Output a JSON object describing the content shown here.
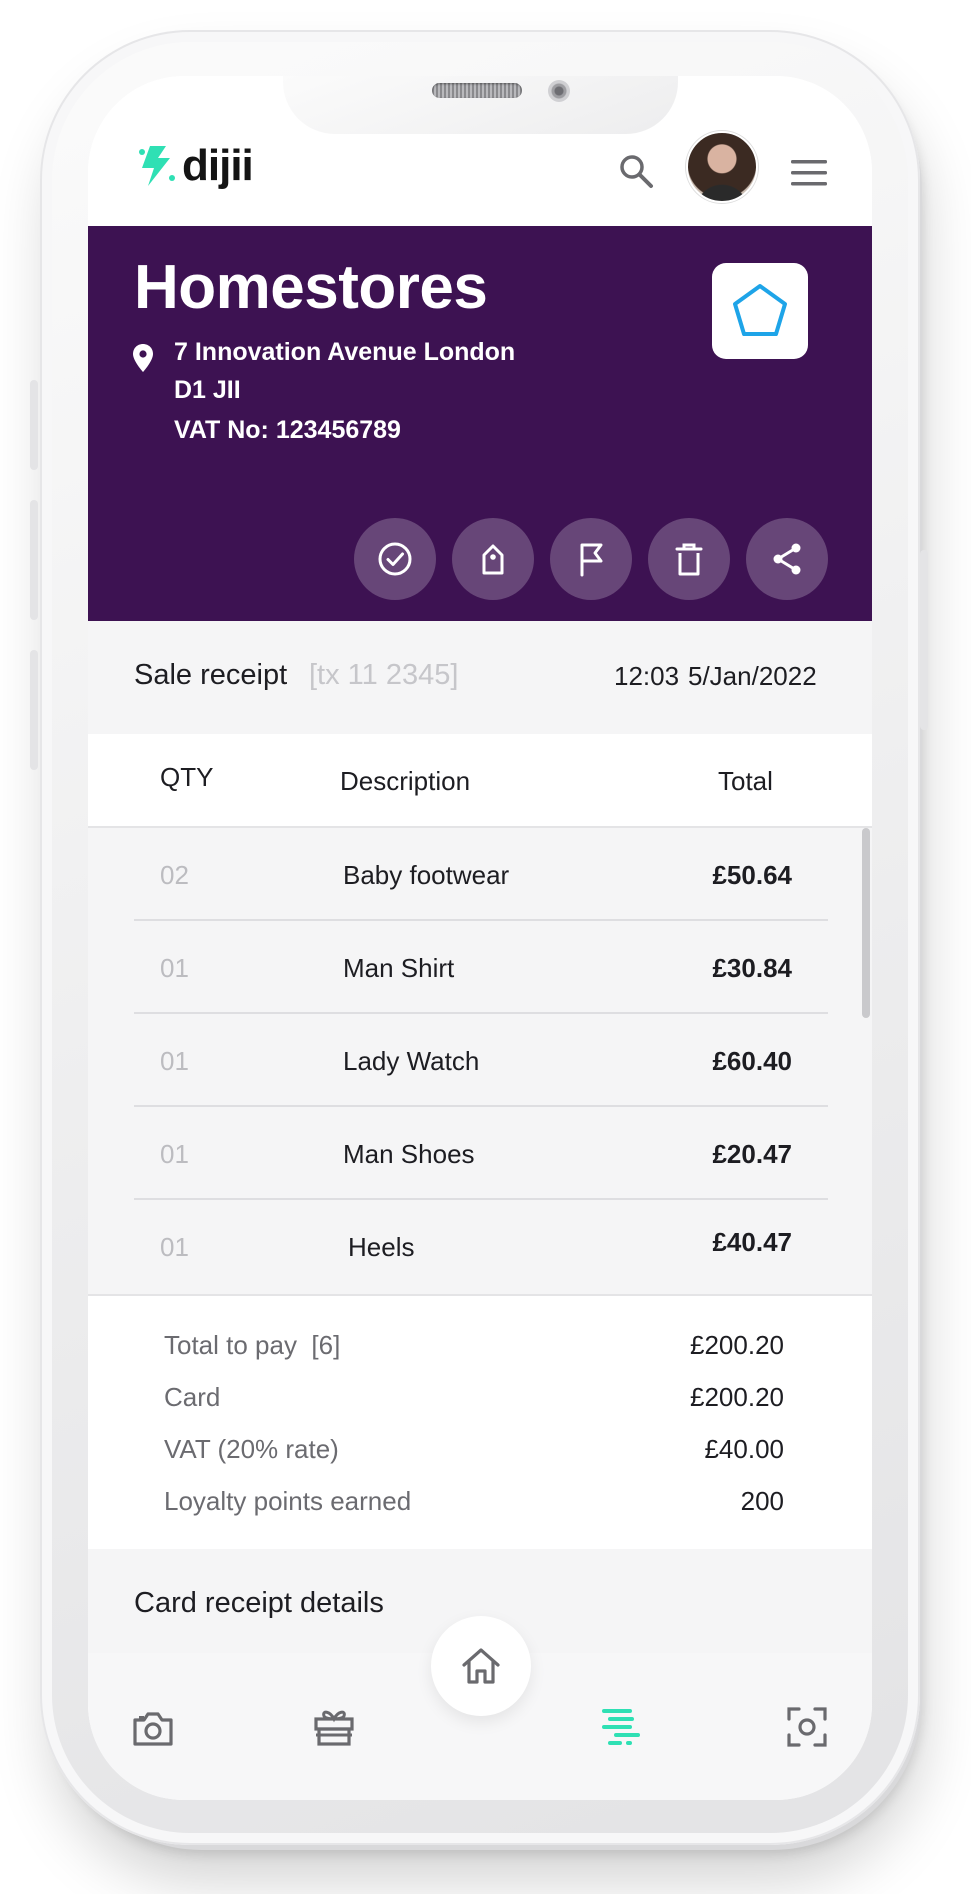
{
  "app": {
    "brand_name": "dijii",
    "brand_color": "#2fe0b4"
  },
  "header": {
    "search_icon": "search-icon",
    "avatar": "user-avatar",
    "menu_icon": "hamburger-menu-icon"
  },
  "store": {
    "name": "Homestores",
    "address_line1": "7 Innovation Avenue London",
    "address_line2": "D1 JII",
    "vat": "VAT No: 123456789",
    "logo_icon": "pentagon-icon",
    "background_color": "#3d1252"
  },
  "actions": [
    {
      "name": "approve",
      "icon": "check-circle-icon"
    },
    {
      "name": "tag",
      "icon": "tag-icon"
    },
    {
      "name": "flag",
      "icon": "flag-icon"
    },
    {
      "name": "delete",
      "icon": "trash-icon"
    },
    {
      "name": "share",
      "icon": "share-icon"
    }
  ],
  "receipt": {
    "title": "Sale receipt",
    "tx": "[tx 11 2345]",
    "time": "12:03",
    "date": "5/Jan/2022"
  },
  "columns": {
    "qty": "QTY",
    "description": "Description",
    "total": "Total"
  },
  "items": [
    {
      "qty": "02",
      "description": "Baby footwear",
      "total": "£50.64"
    },
    {
      "qty": "01",
      "description": "Man Shirt",
      "total": "£30.84"
    },
    {
      "qty": "01",
      "description": "Lady Watch",
      "total": "£60.40"
    },
    {
      "qty": "01",
      "description": "Man Shoes",
      "total": "£20.47"
    },
    {
      "qty": "01",
      "description": "Heels",
      "total": "£40.47"
    }
  ],
  "summary": {
    "total_label": "Total to pay  [6]",
    "total_value": "£200.20",
    "card_label": "Card",
    "card_value": "£200.20",
    "vat_label": "VAT (20% rate)",
    "vat_value": "£40.00",
    "loyalty_label": "Loyalty points earned",
    "loyalty_value": "200"
  },
  "card_section": {
    "title": "Card receipt details"
  },
  "bottom_nav": [
    {
      "name": "camera",
      "icon": "camera-icon",
      "active": false
    },
    {
      "name": "gifts",
      "icon": "gift-icon",
      "active": false
    },
    {
      "name": "home",
      "icon": "home-icon",
      "active": false
    },
    {
      "name": "receipts",
      "icon": "receipts-list-icon",
      "active": true
    },
    {
      "name": "scan",
      "icon": "scan-icon",
      "active": false
    }
  ]
}
